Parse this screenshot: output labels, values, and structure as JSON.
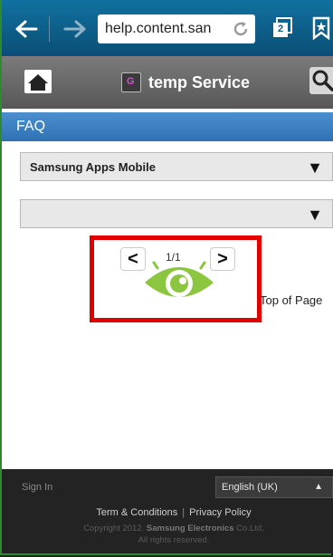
{
  "browser": {
    "url": "help.content.san",
    "tab_count": "2",
    "icons": {
      "back": "back-arrow-icon",
      "forward": "forward-arrow-icon",
      "refresh": "refresh-icon",
      "tabs": "tabs-icon",
      "bookmark": "bookmark-icon"
    }
  },
  "header": {
    "title": "temp Service",
    "icons": {
      "home": "home-icon",
      "logo": "service-logo-icon",
      "search": "search-icon"
    }
  },
  "faq": {
    "title": "FAQ",
    "select_category": "Samsung Apps Mobile",
    "select_subcategory": ""
  },
  "pagination": {
    "current": "1/1",
    "prev_symbol": "<",
    "next_symbol": ">",
    "highlight_color": "#e10000"
  },
  "top_of_page": "Top of Page",
  "footer": {
    "sign_in": "Sign In",
    "language": "English (UK)",
    "terms": "Term & Conditions",
    "separator": "|",
    "privacy": "Privacy Policy",
    "copyright_prefix": "Copyright 2012.",
    "copyright_company": "Samsung Electronics",
    "copyright_suffix": "Co.Ltd.",
    "rights": "All rights reserved."
  },
  "colors": {
    "browser_bar": "#0c5b85",
    "header_bar": "#676767",
    "faq_bar": "#3a7fc1",
    "footer_bg": "#232323",
    "eye_green": "#8cc63f"
  }
}
